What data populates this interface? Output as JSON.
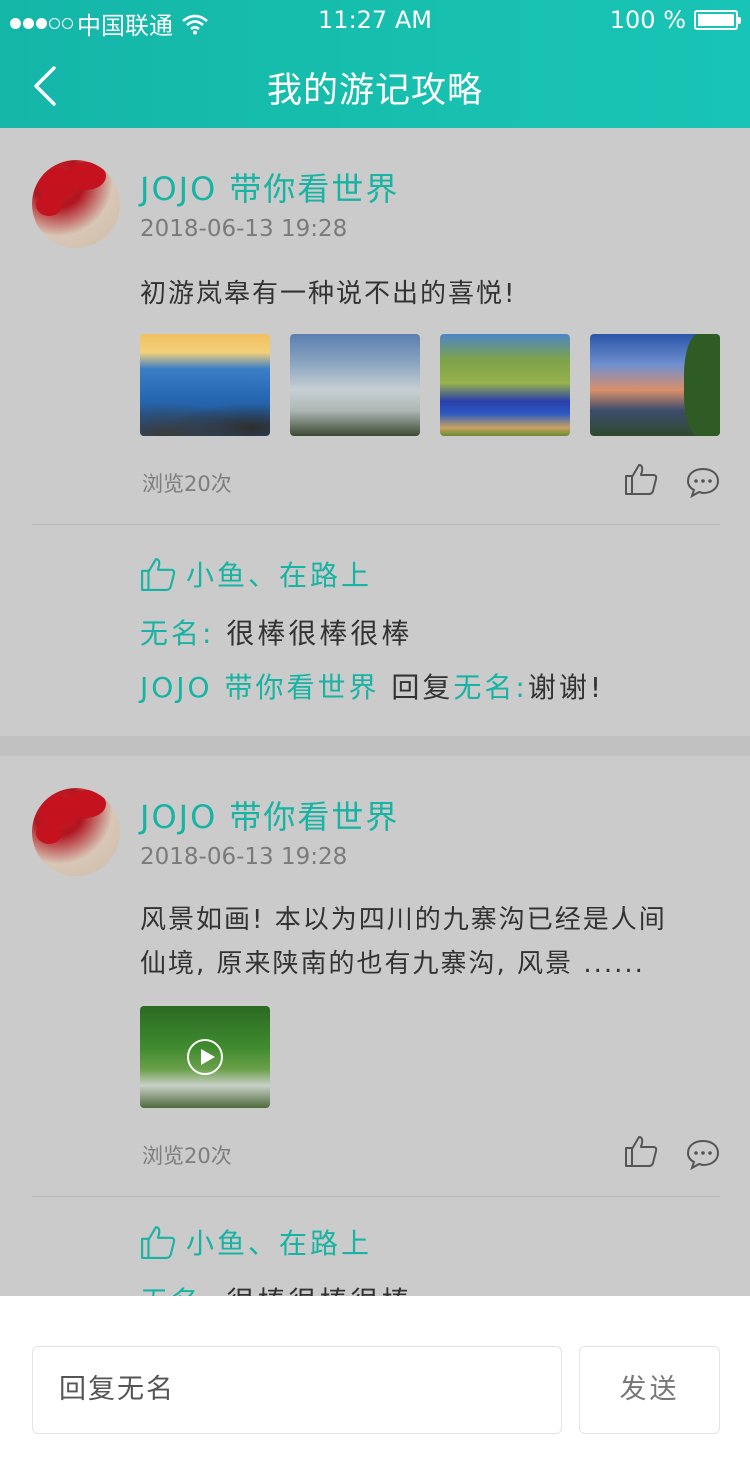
{
  "status_bar": {
    "carrier": "中国联通",
    "time": "11:27 AM",
    "battery": "100 %",
    "battery_level": 1.0
  },
  "nav": {
    "title": "我的游记攻略"
  },
  "posts": [
    {
      "user": "JOJO 带你看世界",
      "date": "2018-06-13  19:28",
      "text": "初游岚皋有一种说不出的喜悦!",
      "views": "浏览20次",
      "likers": "小鱼、在路上",
      "comments": [
        {
          "author": "无名:",
          "text": "很棒很棒很棒"
        }
      ],
      "reply": {
        "author": "JOJO 带你看世界",
        "verb": "回复",
        "target": "无名:",
        "text": "谢谢!"
      }
    },
    {
      "user": "JOJO 带你看世界",
      "date": "2018-06-13  19:28",
      "text_line1": "风景如画! 本以为四川的九寨沟已经是人间",
      "text_line2": "仙境, 原来陕南的也有九寨沟, 风景 ......",
      "views": "浏览20次",
      "likers": "小鱼、在路上",
      "comments": [
        {
          "author": "无名:",
          "text": "很棒很棒很棒"
        }
      ]
    }
  ],
  "reply_bar": {
    "placeholder": "回复无名",
    "send_label": "发送"
  },
  "colors": {
    "accent": "#17b3a3",
    "header": "#16bcae",
    "background": "#cbcbcb"
  }
}
